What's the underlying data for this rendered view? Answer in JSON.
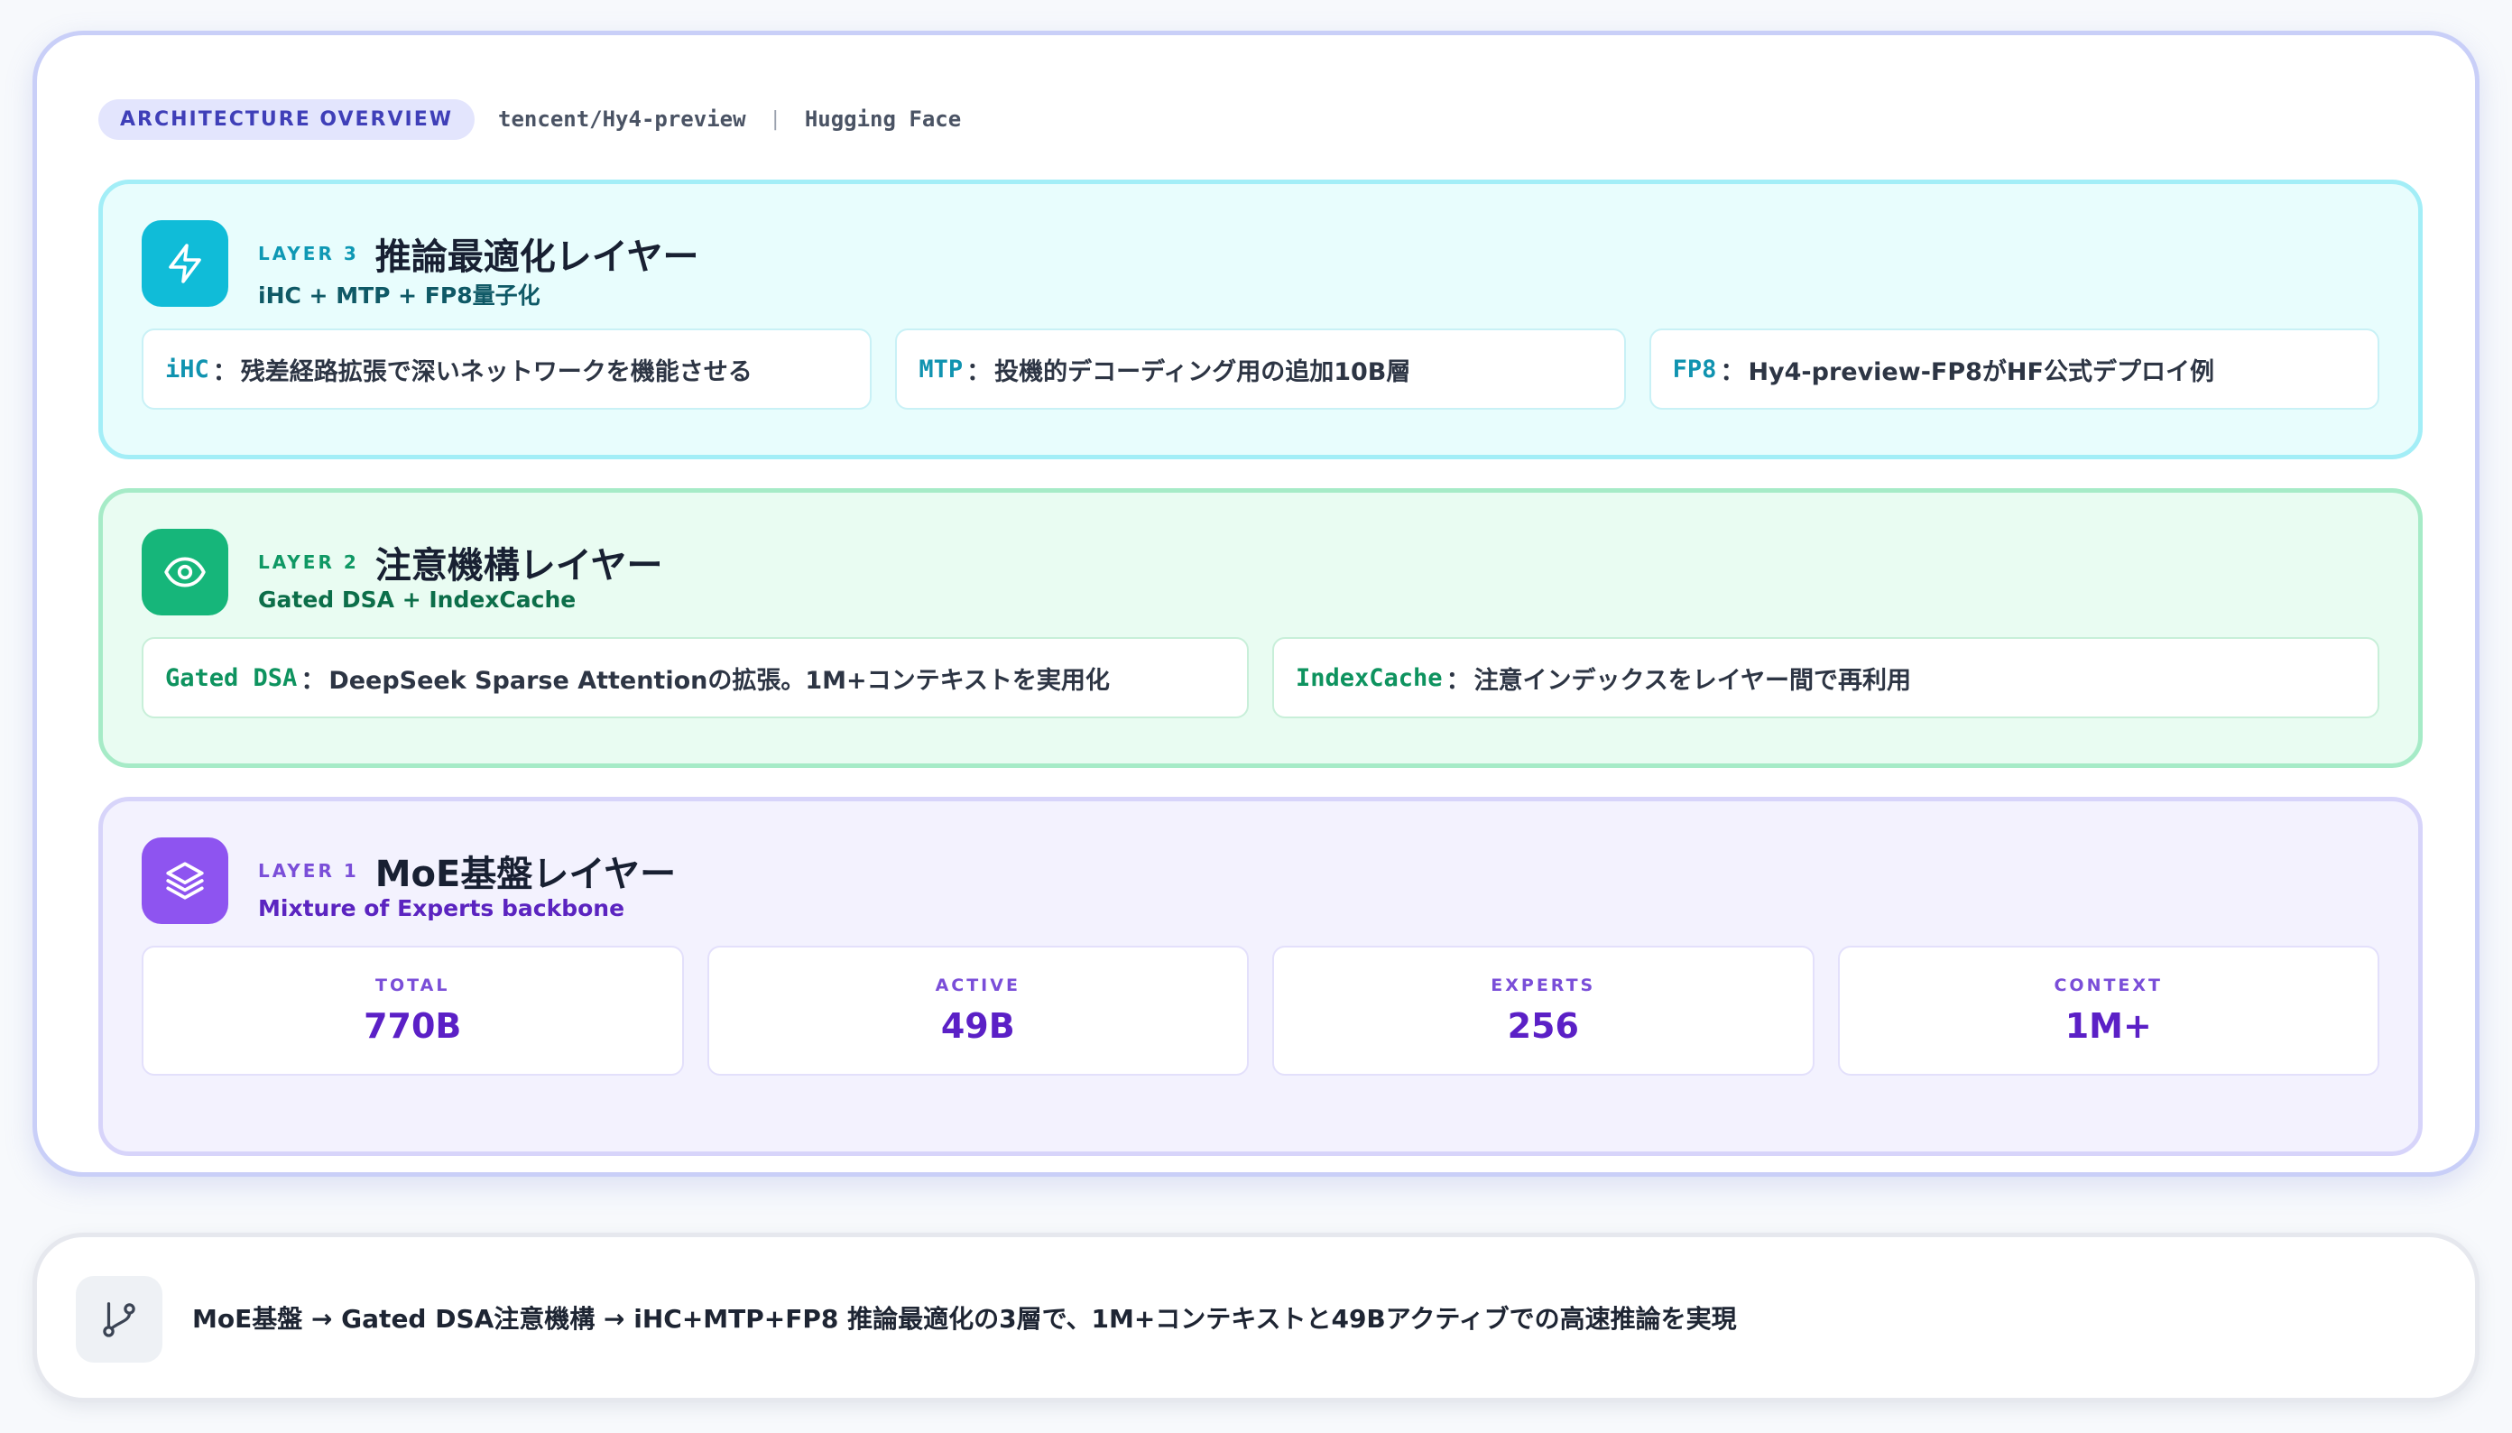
{
  "header": {
    "badge": "ARCHITECTURE OVERVIEW",
    "repo": "tencent/Hy4-preview",
    "separator": "|",
    "source": "Hugging Face"
  },
  "layers": {
    "layer3": {
      "tag": "LAYER 3",
      "title": "推論最適化レイヤー",
      "subtitle": "iHC + MTP + FP8量子化",
      "icon": "lightning-icon",
      "color": "#10bcd8",
      "items": [
        {
          "key": "iHC",
          "text": "残差経路拡張で深いネットワークを機能させる"
        },
        {
          "key": "MTP",
          "text": "投機的デコーディング用の追加10B層"
        },
        {
          "key": "FP8",
          "text": "Hy4-preview-FP8がHF公式デプロイ例"
        }
      ]
    },
    "layer2": {
      "tag": "LAYER 2",
      "title": "注意機構レイヤー",
      "subtitle": "Gated DSA + IndexCache",
      "icon": "eye-icon",
      "color": "#16b67a",
      "items": [
        {
          "key": "Gated DSA",
          "text": "DeepSeek Sparse Attentionの拡張。1M+コンテキストを実用化"
        },
        {
          "key": "IndexCache",
          "text": "注意インデックスをレイヤー間で再利用"
        }
      ]
    },
    "layer1": {
      "tag": "LAYER 1",
      "title": "MoE基盤レイヤー",
      "subtitle": "Mixture of Experts backbone",
      "icon": "layers-icon",
      "color": "#8e54f0",
      "stats": [
        {
          "label": "TOTAL",
          "value": "770B"
        },
        {
          "label": "ACTIVE",
          "value": "49B"
        },
        {
          "label": "EXPERTS",
          "value": "256"
        },
        {
          "label": "CONTEXT",
          "value": "1M+"
        }
      ]
    }
  },
  "footer": {
    "icon": "git-branch-icon",
    "text": "MoE基盤 → Gated DSA注意機構 → iHC+MTP+FP8 推論最適化の3層で、1M+コンテキストと49Bアクティブでの高速推論を実現"
  }
}
